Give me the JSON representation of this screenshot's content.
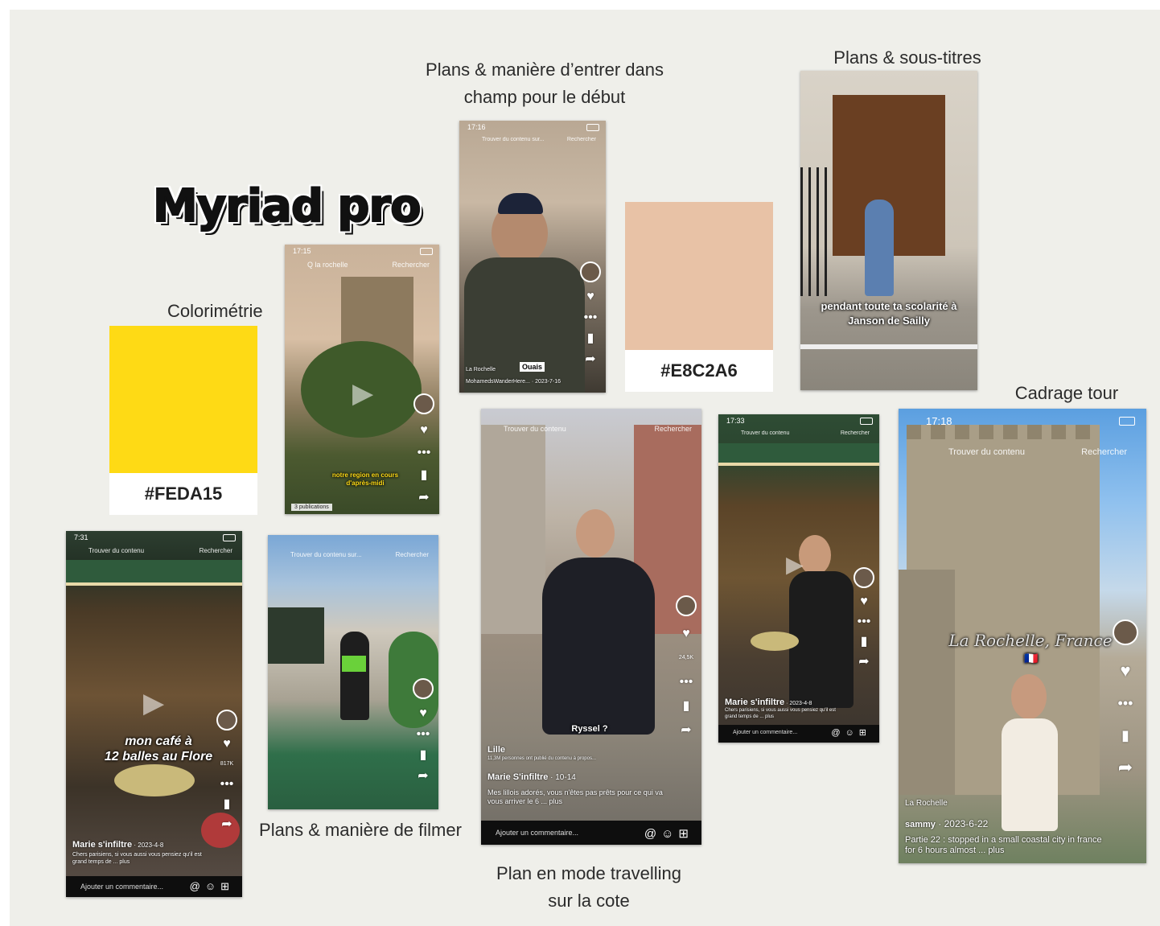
{
  "board": {
    "font_title": "Myriad pro",
    "labels": {
      "colorimetrie": "Colorimétrie",
      "entrer_line1": "Plans & manière d’entrer dans",
      "entrer_line2": "champ pour le début",
      "sous_titres": "Plans & sous-titres",
      "cadrage": "Cadrage tour",
      "filmer": "Plans & manière de filmer",
      "travelling_line1": "Plan en mode travelling",
      "travelling_line2": "sur la cote"
    },
    "swatches": [
      {
        "code": "#FEDA15",
        "color": "#FEDA15"
      },
      {
        "code": "#E8C2A6",
        "color": "#E8C2A6"
      }
    ]
  },
  "phones": {
    "tower_sunset": {
      "time": "17:15",
      "search": "Q   la rochelle",
      "search_right": "Rechercher",
      "subtitle_line1": "notre region en cours",
      "subtitle_line2": "d'après-midi",
      "publications": "3 publications"
    },
    "man_cap": {
      "time": "17:16",
      "search": "Trouver du contenu sur...",
      "search_right": "Rechercher",
      "sticker": "Ouais",
      "place": "La Rochelle",
      "handle": "MohamedsWanderHere...",
      "date": "2023-7-16"
    },
    "janson": {
      "subtitle_line1": "pendant toute ta scolarité à",
      "subtitle_line2": "Janson de Sailly"
    },
    "cafe_left": {
      "time": "7:31",
      "search": "Trouver du contenu",
      "search_right": "Rechercher",
      "overlay_line1": "mon café à",
      "overlay_line2": "12 balles au Flore",
      "handle": "Marie s'infiltre",
      "date": "2023-4-8",
      "caption": "Chers parisiens, si vous aussi vous pensiez qu'il est grand temps de ... plus",
      "comment": "Ajouter un commentaire...",
      "likes": "817K"
    },
    "bike": {
      "search": "Trouver du contenu sur...",
      "search_right": "Rechercher"
    },
    "travelling": {
      "search": "Trouver du contenu",
      "search_right": "Rechercher",
      "overlay": "Ryssel ?",
      "place": "Lille",
      "place_sub": "11,3M personnes ont publié du contenu à propos...",
      "handle": "Marie S'infiltre",
      "date": "10-14",
      "caption": "Mes lillois adorés, vous n'êtes pas prêts pour ce qui va vous arriver le 6 ... plus",
      "comment": "Ajouter un commentaire...",
      "likes": "24,5K"
    },
    "cafe_right": {
      "time": "17:33",
      "search": "Trouver du contenu",
      "search_right": "Rechercher",
      "handle": "Marie s'infiltre",
      "date": "2023-4-8",
      "caption": "Chers parisiens, si vous aussi vous pensiez qu'il est grand temps de ... plus",
      "comment": "Ajouter un commentaire..."
    },
    "tower_bright": {
      "time": "17:18",
      "search": "Trouver du contenu",
      "search_right": "Rechercher",
      "overlay": "La Rochelle, France",
      "flag": "🇫🇷",
      "place": "La Rochelle",
      "handle": "sammy",
      "date": "2023-6-22",
      "caption": "Partie 22 : stopped in a small coastal city in france for 6 hours almost ... plus"
    }
  }
}
